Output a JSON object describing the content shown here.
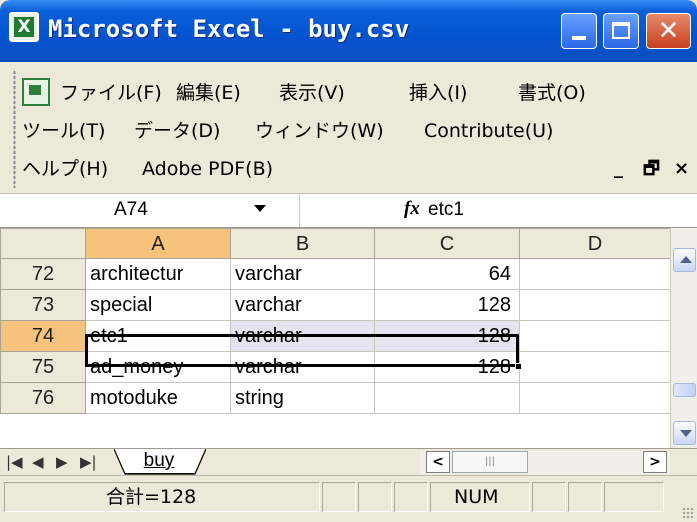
{
  "window": {
    "title": "Microsoft Excel - buy.csv",
    "app_icon": "excel-icon",
    "controls": [
      "minimize",
      "maximize",
      "close"
    ],
    "close_glyph": "✕"
  },
  "menu": {
    "row1": [
      "ファイル(F)",
      "編集(E)",
      "表示(V)",
      "挿入(I)",
      "書式(O)"
    ],
    "row2": [
      "ツール(T)",
      "データ(D)",
      "ウィンドウ(W)",
      "Contribute(U)"
    ],
    "row3": [
      "ヘルプ(H)",
      "Adobe PDF(B)"
    ],
    "doc_min": "_",
    "doc_restore": "🗗",
    "doc_close": "×"
  },
  "formula_bar": {
    "name_box": "A74",
    "fx_label": "fx",
    "value": "etc1"
  },
  "grid": {
    "columns": [
      "A",
      "B",
      "C",
      "D"
    ],
    "selected_column": "A",
    "rows": [
      {
        "num": "72",
        "a": "architectur",
        "b": "varchar",
        "c": "64",
        "d": ""
      },
      {
        "num": "73",
        "a": "special",
        "b": "varchar",
        "c": "128",
        "d": ""
      },
      {
        "num": "74",
        "a": "etc1",
        "b": "varchar",
        "c": "128",
        "d": ""
      },
      {
        "num": "75",
        "a": "ad_money",
        "b": "varchar",
        "c": "128",
        "d": ""
      },
      {
        "num": "76",
        "a": "motoduke",
        "b": "string",
        "c": "",
        "d": ""
      }
    ],
    "selected_row": "74"
  },
  "sheet_tabs": {
    "nav": [
      "|◀",
      "◀",
      "▶",
      "▶|"
    ],
    "tabs": [
      "buy"
    ],
    "hscroll_left": "<",
    "hscroll_right": ">",
    "hscroll_thumb": "|||"
  },
  "status": {
    "sum": "合計=128",
    "num": "NUM"
  },
  "colors": {
    "titlebar": "#0553cf",
    "selected_header": "#f7c27c",
    "chrome": "#ece9d8"
  }
}
